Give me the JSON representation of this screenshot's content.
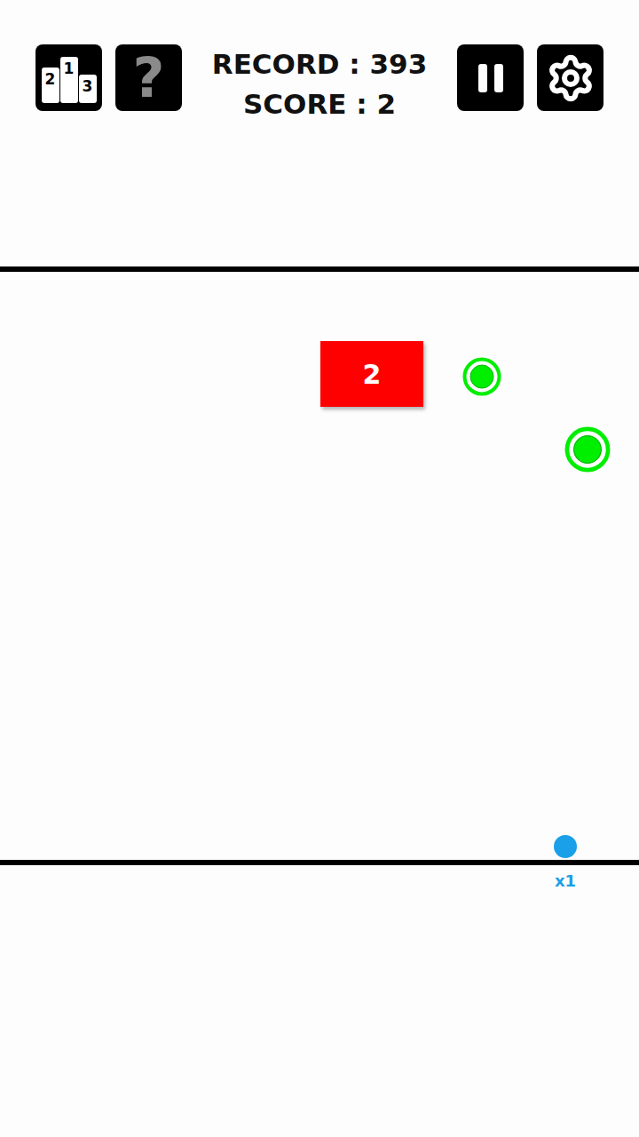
{
  "toolbar": {
    "podium_ranks": [
      "2",
      "1",
      "3"
    ],
    "help": "?"
  },
  "scores": {
    "record": "RECORD : 393",
    "score": "SCORE : 2"
  },
  "items": [
    {
      "kind": "block",
      "label": "2"
    },
    {
      "kind": "ring"
    },
    {
      "kind": "ring"
    }
  ],
  "ball": {
    "multiplier": "x1"
  }
}
